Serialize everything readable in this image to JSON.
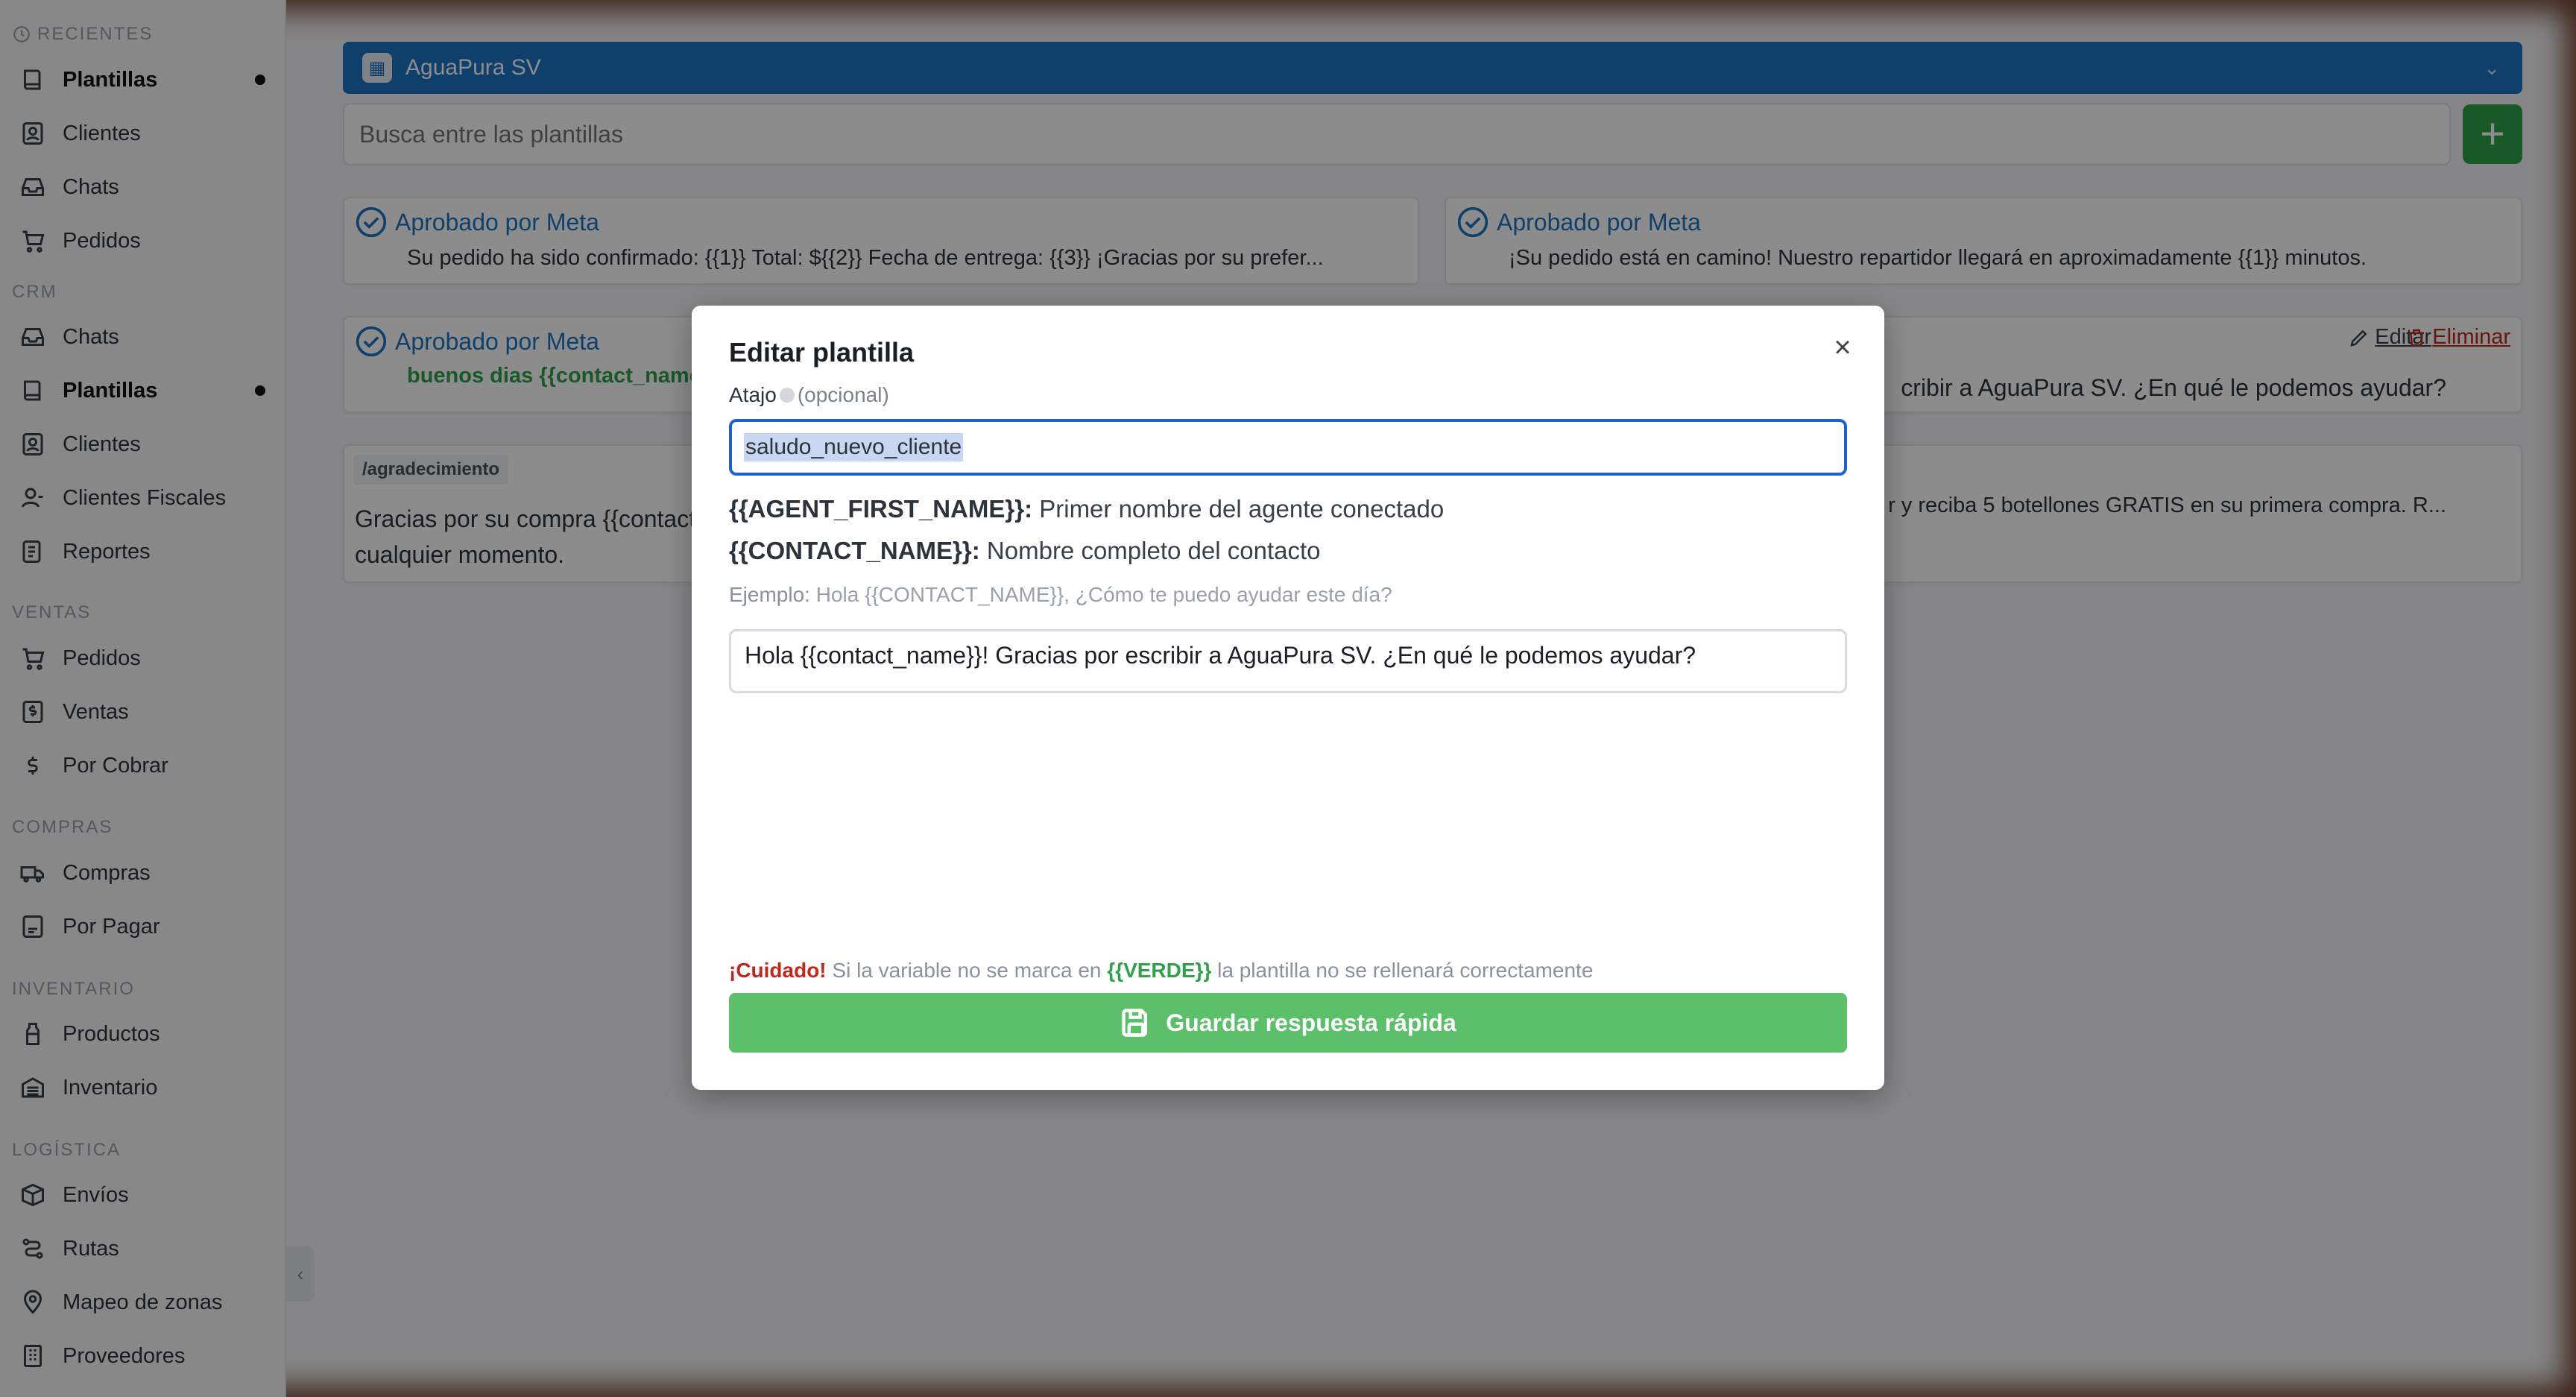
{
  "sidebar": {
    "sections": [
      {
        "label": "RECIENTES"
      },
      {
        "label": "CRM"
      },
      {
        "label": "VENTAS"
      },
      {
        "label": "COMPRAS"
      },
      {
        "label": "INVENTARIO"
      },
      {
        "label": "LOGÍSTICA"
      }
    ],
    "items": [
      {
        "label": "Plantillas",
        "icon": "book-icon"
      },
      {
        "label": "Clientes",
        "icon": "contact-icon"
      },
      {
        "label": "Chats",
        "icon": "inbox-icon"
      },
      {
        "label": "Pedidos",
        "icon": "cart-icon"
      },
      {
        "label": "Chats",
        "icon": "inbox-icon"
      },
      {
        "label": "Plantillas",
        "icon": "book-icon"
      },
      {
        "label": "Clientes",
        "icon": "contact-icon"
      },
      {
        "label": "Clientes Fiscales",
        "icon": "user-icon"
      },
      {
        "label": "Reportes",
        "icon": "report-icon"
      },
      {
        "label": "Pedidos",
        "icon": "cart-icon"
      },
      {
        "label": "Ventas",
        "icon": "dollar-square-icon"
      },
      {
        "label": "Por Cobrar",
        "icon": "dollar-icon"
      },
      {
        "label": "Compras",
        "icon": "truck-icon"
      },
      {
        "label": "Por Pagar",
        "icon": "invoice-icon"
      },
      {
        "label": "Productos",
        "icon": "bottle-icon"
      },
      {
        "label": "Inventario",
        "icon": "warehouse-icon"
      },
      {
        "label": "Envíos",
        "icon": "package-icon"
      },
      {
        "label": "Rutas",
        "icon": "route-icon"
      },
      {
        "label": "Mapeo de zonas",
        "icon": "map-pin-icon"
      },
      {
        "label": "Proveedores",
        "icon": "building-icon"
      }
    ]
  },
  "header": {
    "company": "AguaPura SV",
    "search_placeholder": "Busca entre las plantillas",
    "add_label": "+"
  },
  "cards": [
    {
      "status": "Aprobado por Meta",
      "text": "Su pedido ha sido confirmado: {{1}} Total: ${{2}} Fecha de entrega: {{3}} ¡Gracias por su prefer..."
    },
    {
      "status": "Aprobado por Meta",
      "text": "¡Su pedido está en camino! Nuestro repartidor llegará en aproximadamente {{1}} minutos."
    },
    {
      "status": "Aprobado por Meta",
      "text": "buenos dias {{contact_name}}"
    },
    {
      "text": "cribir a AguaPura SV. ¿En qué le podemos ayudar?",
      "edit_label": "Editar",
      "delete_label": "Eliminar"
    },
    {
      "tag": "/agradecimiento",
      "text": "Gracias por su compra {{contact_name}}",
      "text2": "cualquier momento."
    },
    {
      "text": "r y reciba 5 botellones GRATIS en su primera compra. R..."
    }
  ],
  "modal": {
    "title": "Editar plantilla",
    "close": "×",
    "shortcut_label": "Atajo",
    "shortcut_optional": "(opcional)",
    "shortcut_value": "saludo_nuevo_cliente",
    "var1_key": "{{AGENT_FIRST_NAME}}:",
    "var1_desc": " Primer nombre del agente conectado",
    "var2_key": "{{CONTACT_NAME}}:",
    "var2_desc": " Nombre completo del contacto",
    "example_label": "Ejemplo:",
    "example_text": " Hola {{CONTACT_NAME}}, ¿Cómo te puedo ayudar este día?",
    "message": "Hola {{contact_name}}! Gracias por escribir a AguaPura SV. ¿En qué le podemos ayudar?",
    "warning_caution": "¡Cuidado!",
    "warning_pre": " Si la variable no se marca en ",
    "warning_var": "{{VERDE}}",
    "warning_post": " la plantilla no se rellenará correctamente",
    "save_label": "Guardar respuesta rápida"
  },
  "colors": {
    "accent_blue": "#1d74c4",
    "success_green": "#5cc06a",
    "danger_red": "#c0281c"
  }
}
